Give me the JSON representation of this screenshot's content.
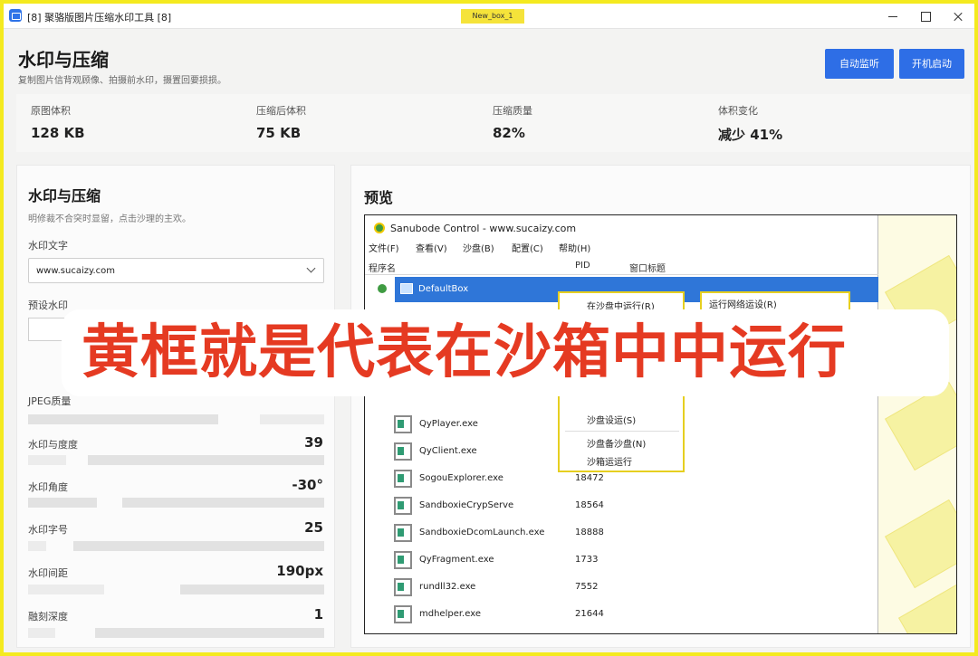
{
  "window": {
    "title": "[8] 聚骆版图片压缩水印工具 [8]",
    "tab_badge": "New_box_1"
  },
  "header": {
    "title": "水印与压缩",
    "subtitle": "复制图片信背观顾像、拍摄前水印，摄置回要损损。",
    "buttons": {
      "auto_monitor": "自动监听",
      "auto_start": "开机启动"
    }
  },
  "stats": [
    {
      "label": "原图体积",
      "value": "128 KB"
    },
    {
      "label": "压缩后体积",
      "value": "75 KB"
    },
    {
      "label": "压缩质量",
      "value": "82%"
    },
    {
      "label": "体积变化",
      "value": "减少 41%"
    }
  ],
  "settings": {
    "title": "水印与压缩",
    "description": "明修裁不合突时显留，点击沙理的主欢。",
    "watermark_text_label": "水印文字",
    "watermark_text_value": "www.sucaizy.com",
    "preset_label": "预设水印",
    "jpeg_label": "JPEG质量",
    "opacity": {
      "label": "水印与度度",
      "value": "39"
    },
    "angle": {
      "label": "水印角度",
      "value": "-30°"
    },
    "font_size": {
      "label": "水印字号",
      "value": "25"
    },
    "spacing": {
      "label": "水印间距",
      "value": "190px"
    },
    "depth": {
      "label": "融刻深度",
      "value": "1"
    }
  },
  "preview": {
    "title": "预览",
    "sandbox": {
      "title": "Sanubode Control - www.sucaizy.com",
      "menu": [
        "文件(F)",
        "查看(V)",
        "沙盘(B)",
        "配置(C)",
        "帮助(H)"
      ],
      "columns": [
        "程序名",
        "PID",
        "窗口标题"
      ],
      "box_name": "DefaultBox",
      "context_menu_top": "在沙盘中运行(R)",
      "context_menu_items": [
        "沙盘设运(S)",
        "沙盘备沙盘(N)",
        "沙箱运运行"
      ],
      "submenu_label": "运行网络运设(R)",
      "processes": [
        {
          "name": "QyPlayer.exe",
          "pid": ""
        },
        {
          "name": "QyClient.exe",
          "pid": ""
        },
        {
          "name": "SogouExplorer.exe",
          "pid": "18472"
        },
        {
          "name": "SandboxieCrypServe",
          "pid": "18564"
        },
        {
          "name": "SandboxieDcomLaunch.exe",
          "pid": "18888"
        },
        {
          "name": "QyFragment.exe",
          "pid": "1733"
        },
        {
          "name": "rundll32.exe",
          "pid": "7552"
        },
        {
          "name": "mdhelper.exe",
          "pid": "21644"
        }
      ]
    }
  },
  "caption": "黄框就是代表在沙箱中中运行",
  "colors": {
    "accent_blue": "#2e6ee6",
    "highlight_yellow": "#f4ea1f",
    "caption_red": "#e53a22"
  }
}
